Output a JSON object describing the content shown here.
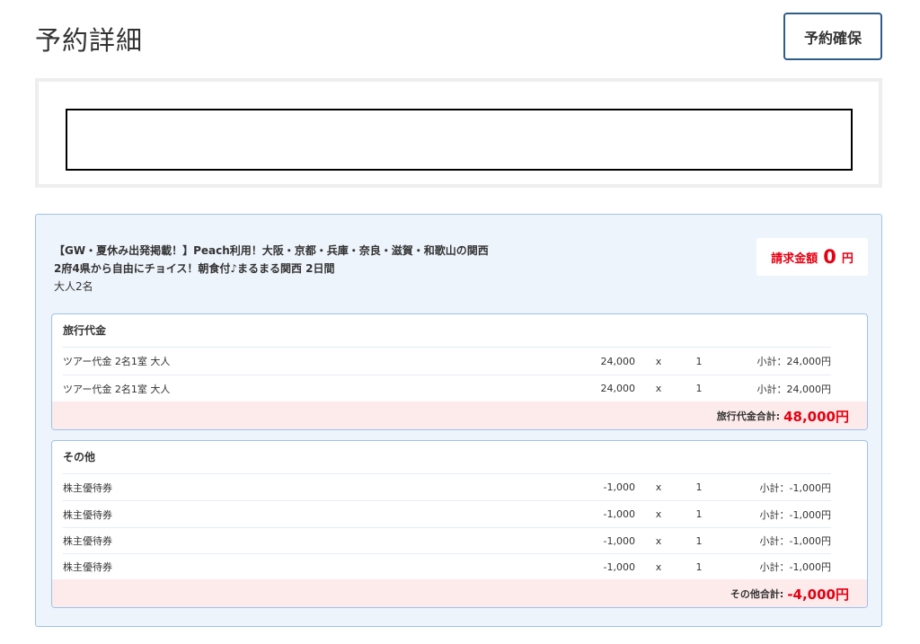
{
  "header": {
    "title": "予約詳細",
    "reserve_button": "予約確保"
  },
  "tour": {
    "title_line1": "【GW・夏休み出発掲載！】Peach利用！大阪・京都・兵庫・奈良・滋賀・和歌山の関西",
    "title_line2": "2府4県から自由にチョイス！朝食付♪まるまる関西 2日間",
    "pax": "大人2名"
  },
  "billing": {
    "label": "請求金額",
    "amount": "0",
    "unit": "円"
  },
  "travel_fee": {
    "heading": "旅行代金",
    "rows": [
      {
        "name": "ツアー代金 2名1室 大人",
        "price": "24,000",
        "times": "x",
        "qty": "1",
        "subtotal": "小計：24,000円"
      },
      {
        "name": "ツアー代金 2名1室 大人",
        "price": "24,000",
        "times": "x",
        "qty": "1",
        "subtotal": "小計：24,000円"
      }
    ],
    "total_label": "旅行代金合計:",
    "total_value": "48,000円"
  },
  "other": {
    "heading": "その他",
    "rows": [
      {
        "name": "株主優待券",
        "price": "-1,000",
        "times": "x",
        "qty": "1",
        "subtotal": "小計：-1,000円"
      },
      {
        "name": "株主優待券",
        "price": "-1,000",
        "times": "x",
        "qty": "1",
        "subtotal": "小計：-1,000円"
      },
      {
        "name": "株主優待券",
        "price": "-1,000",
        "times": "x",
        "qty": "1",
        "subtotal": "小計：-1,000円"
      },
      {
        "name": "株主優待券",
        "price": "-1,000",
        "times": "x",
        "qty": "1",
        "subtotal": "小計：-1,000円"
      }
    ],
    "total_label": "その他合計:",
    "total_value": "-4,000円"
  },
  "colors": {
    "accent_red": "#e60012",
    "panel_bg": "#eef4fc",
    "panel_border": "#9cc2ec",
    "total_bg": "#fdeaea",
    "button_border": "#2e5d8c"
  }
}
